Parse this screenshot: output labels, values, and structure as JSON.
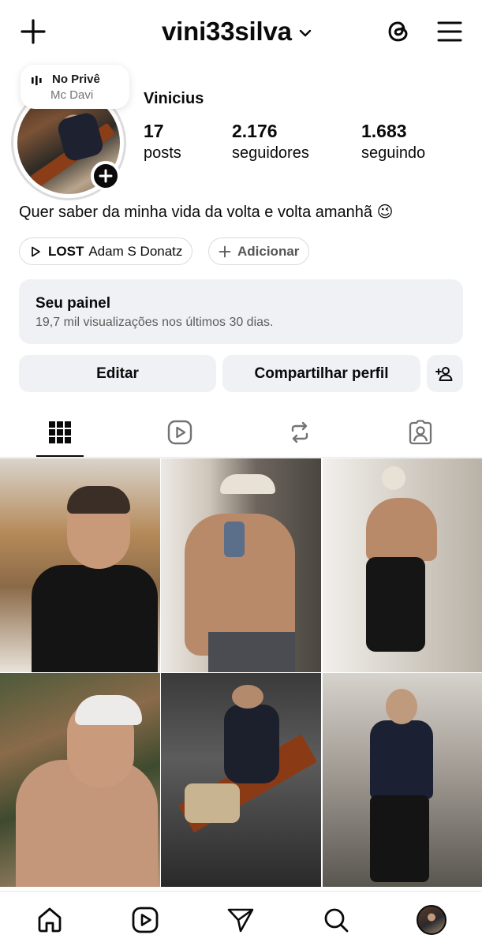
{
  "header": {
    "username": "vini33silva",
    "icons": [
      "plus-icon",
      "chevron-down-icon",
      "threads-icon",
      "menu-icon"
    ]
  },
  "note": {
    "song": "No Privê",
    "artist": "Mc Davi",
    "icon": "audio-bars-icon"
  },
  "profile": {
    "display_name": "Vinicius",
    "stats": [
      {
        "value": "17",
        "label": "posts"
      },
      {
        "value": "2.176",
        "label": "seguidores"
      },
      {
        "value": "1.683",
        "label": "seguindo"
      }
    ],
    "bio": "Quer saber da minha vida da volta e volta amanhã 😉"
  },
  "chips": {
    "music_title": "LOST",
    "music_artist": "Adam S Donatz",
    "add_label": "Adicionar"
  },
  "dashboard": {
    "title": "Seu painel",
    "subtitle": "19,7 mil visualizações nos últimos 30 dias."
  },
  "actions": {
    "edit_label": "Editar",
    "share_label": "Compartilhar perfil",
    "suggest_icon": "add-person-icon"
  },
  "tabs": [
    {
      "name": "grid",
      "icon": "grid-icon",
      "active": true
    },
    {
      "name": "reels",
      "icon": "reels-icon",
      "active": false
    },
    {
      "name": "reposts",
      "icon": "repost-icon",
      "active": false
    },
    {
      "name": "tagged",
      "icon": "tagged-icon",
      "active": false
    }
  ],
  "posts_visible": 6,
  "bottom_nav": [
    "home-icon",
    "reels-icon",
    "send-icon",
    "search-icon",
    "profile-avatar"
  ],
  "colors": {
    "text": "#0a0a0a",
    "secondary_text": "#737373",
    "button_bg": "#eff1f4",
    "border": "#dbdbdb"
  }
}
